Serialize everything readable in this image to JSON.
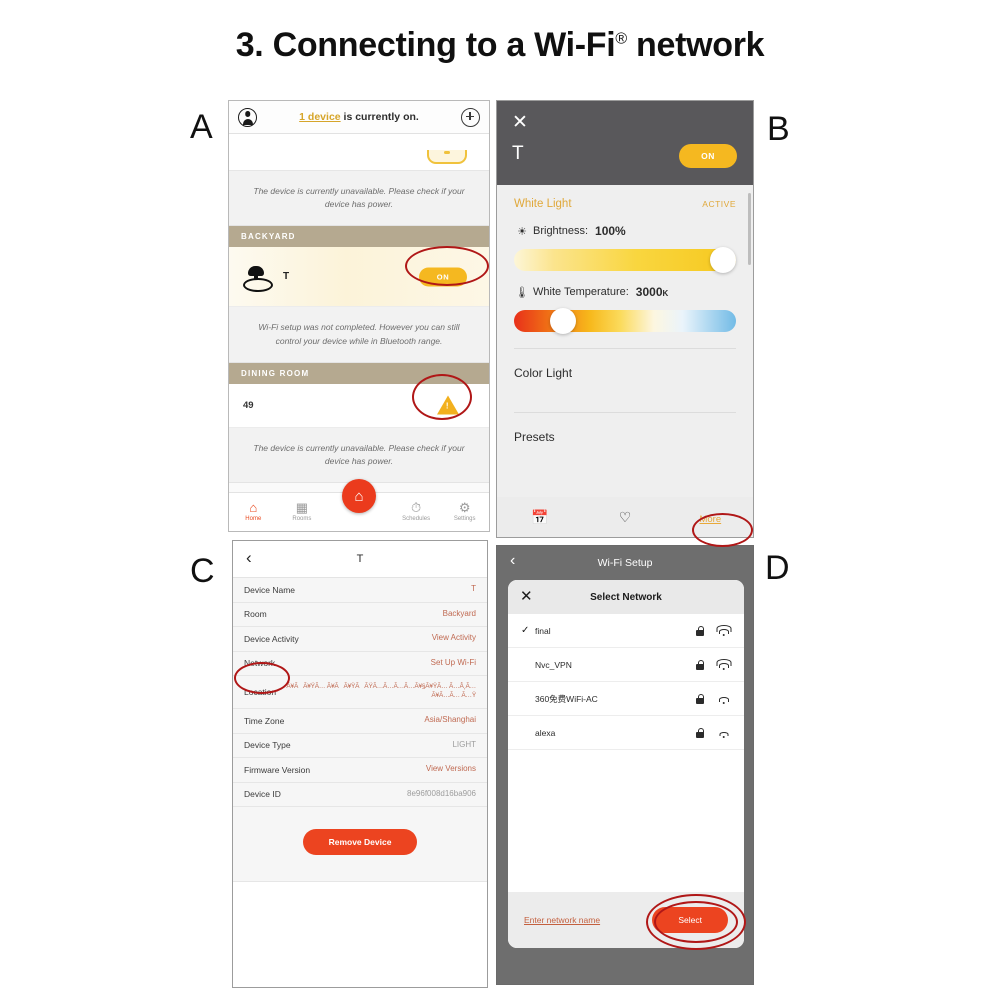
{
  "title": "3. Connecting to a Wi-Fi® network",
  "title_main": "3. Connecting to a Wi-Fi",
  "title_sup": "®",
  "title_tail": " network",
  "panel_letters": {
    "a": "A",
    "b": "B",
    "c": "C",
    "d": "D"
  },
  "colors": {
    "accent_amber": "#f5b820",
    "accent_red": "#ec4420",
    "highlight_ellipse": "#b01717",
    "dark_header": "#59585b",
    "section_band": "#b5a990"
  },
  "panel_a": {
    "topbar": {
      "avatar_icon": "account-avatar-icon",
      "link_text": "1 device",
      "text_rest": " is currently on.",
      "add_icon": "plus-circle-icon"
    },
    "note_1": "The device is currently unavailable. Please check if your device has power.",
    "section_backyard": "BACKYARD",
    "device": {
      "icon": "pendant-lamp-icon",
      "name": "T",
      "toggle_label": "ON",
      "toggle_state": "on"
    },
    "note_2": "Wi-Fi setup was not completed. However you can still control your device while in Bluetooth range.",
    "section_dining": "DINING ROOM",
    "device_2": {
      "name": "49",
      "status_icon": "warning-triangle-icon"
    },
    "note_3": "The device is currently unavailable. Please check if your device has power.",
    "fab_icon": "home-fab-icon",
    "tabs": [
      {
        "label": "Home",
        "icon": "home-icon",
        "active": true
      },
      {
        "label": "Rooms",
        "icon": "rooms-grid-icon",
        "active": false
      },
      {
        "label": "Schedules",
        "icon": "clock-icon",
        "active": false
      },
      {
        "label": "Settings",
        "icon": "gear-icon",
        "active": false
      }
    ]
  },
  "panel_b": {
    "close_icon": "close-icon",
    "device_title": "T",
    "toggle_label": "ON",
    "mode_label": "White Light",
    "mode_status": "ACTIVE",
    "brightness": {
      "icon": "sun-icon",
      "label": "Brightness:",
      "value": "100%",
      "percent": 100
    },
    "white_temperature": {
      "icon": "thermometer-icon",
      "label": "White Temperature:",
      "value": "3000",
      "unit": "K",
      "position_percent": 22
    },
    "rows": [
      "Color Light",
      "Presets"
    ],
    "footer": [
      {
        "label": "",
        "icon": "schedule-calendar-icon"
      },
      {
        "label": "",
        "icon": "heart-icon"
      },
      {
        "label": "More",
        "icon": "more-link"
      }
    ]
  },
  "panel_c": {
    "back_icon": "back-chevron-icon",
    "nav_title": "T",
    "rows": [
      {
        "key": "Device Name",
        "value": "T",
        "style": "accent"
      },
      {
        "key": "Room",
        "value": "Backyard",
        "style": "accent"
      },
      {
        "key": "Device Activity",
        "value": "View Activity",
        "style": "accent"
      },
      {
        "key": "Network",
        "value": "Set Up Wi-Fi",
        "style": "accent"
      },
      {
        "key": "Location",
        "value": "Ã¥ÃÃ¥ŸÃ… Ã¥ÃÃ¥ŸÃÃŸÃ…Ã…Ã…Ã…Ã¥§Ã¥ŸÃ… Ã…Â¸Ã…Ã¥Ã…Ã… Ã…Ÿ",
        "style": "accent tiny"
      },
      {
        "key": "Time Zone",
        "value": "Asia/Shanghai",
        "style": "accent"
      },
      {
        "key": "Device Type",
        "value": "LIGHT",
        "style": "grey"
      },
      {
        "key": "Firmware Version",
        "value": "View Versions",
        "style": "accent"
      },
      {
        "key": "Device ID",
        "value": "8e96f008d16ba906",
        "style": "grey"
      }
    ],
    "remove_button": "Remove Device"
  },
  "panel_d": {
    "back_icon": "back-chevron-icon",
    "nav_title": "Wi-Fi Setup",
    "sheet": {
      "close_icon": "close-icon",
      "title": "Select Network",
      "networks": [
        {
          "name": "final",
          "selected": true,
          "locked": true,
          "signal": 3
        },
        {
          "name": "Nvc_VPN",
          "selected": false,
          "locked": true,
          "signal": 3
        },
        {
          "name": "360免费WiFi-AC",
          "selected": false,
          "locked": true,
          "signal": 2
        },
        {
          "name": "alexa",
          "selected": false,
          "locked": true,
          "signal": 1
        }
      ],
      "enter_network_link": "Enter network name",
      "select_button": "Select"
    }
  }
}
